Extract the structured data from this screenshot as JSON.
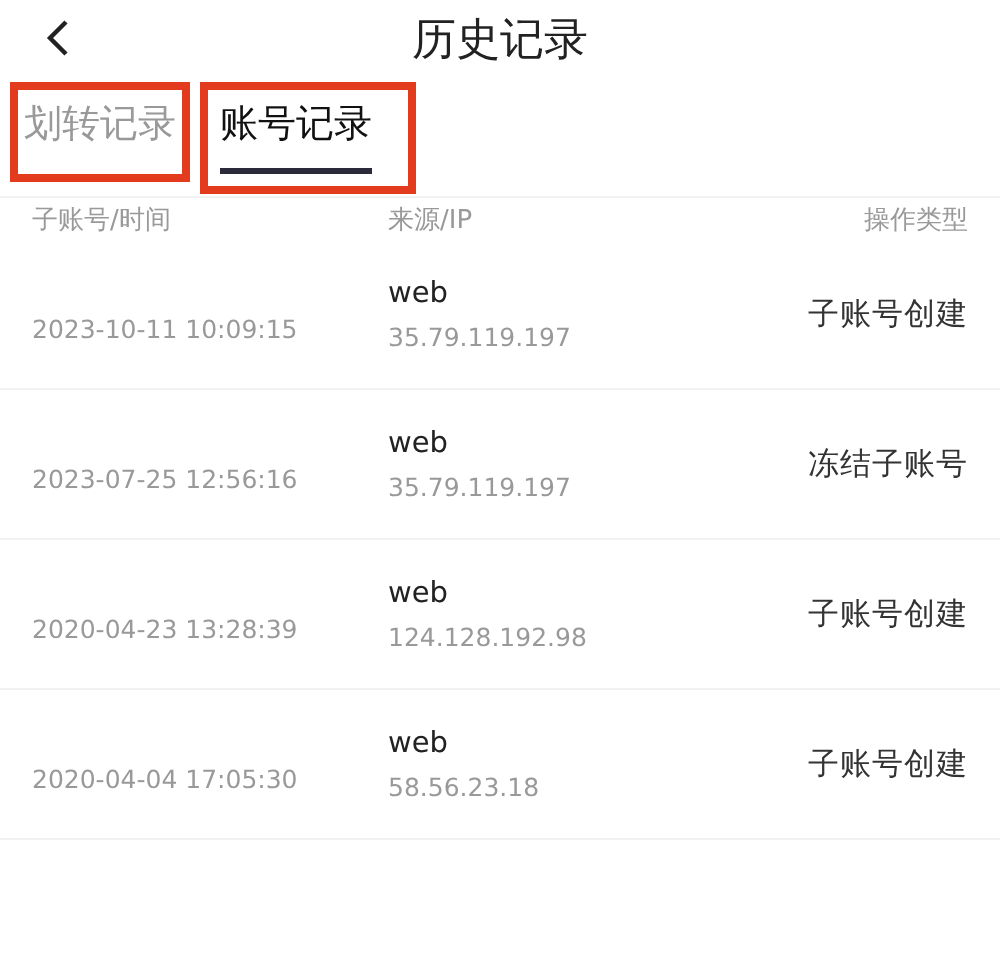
{
  "header": {
    "title": "历史记录"
  },
  "tabs": [
    {
      "label": "划转记录",
      "selected": false,
      "highlighted": true
    },
    {
      "label": "账号记录",
      "selected": true,
      "highlighted": true
    }
  ],
  "table": {
    "columns": [
      "子账号/时间",
      "来源/IP",
      "操作类型"
    ],
    "rows": [
      {
        "time": "2023-10-11 10:09:15",
        "source": "web",
        "ip": "35.79.119.197",
        "action": "子账号创建"
      },
      {
        "time": "2023-07-25 12:56:16",
        "source": "web",
        "ip": "35.79.119.197",
        "action": "冻结子账号"
      },
      {
        "time": "2020-04-23 13:28:39",
        "source": "web",
        "ip": "124.128.192.98",
        "action": "子账号创建"
      },
      {
        "time": "2020-04-04 17:05:30",
        "source": "web",
        "ip": "58.56.23.18",
        "action": "子账号创建"
      }
    ]
  }
}
